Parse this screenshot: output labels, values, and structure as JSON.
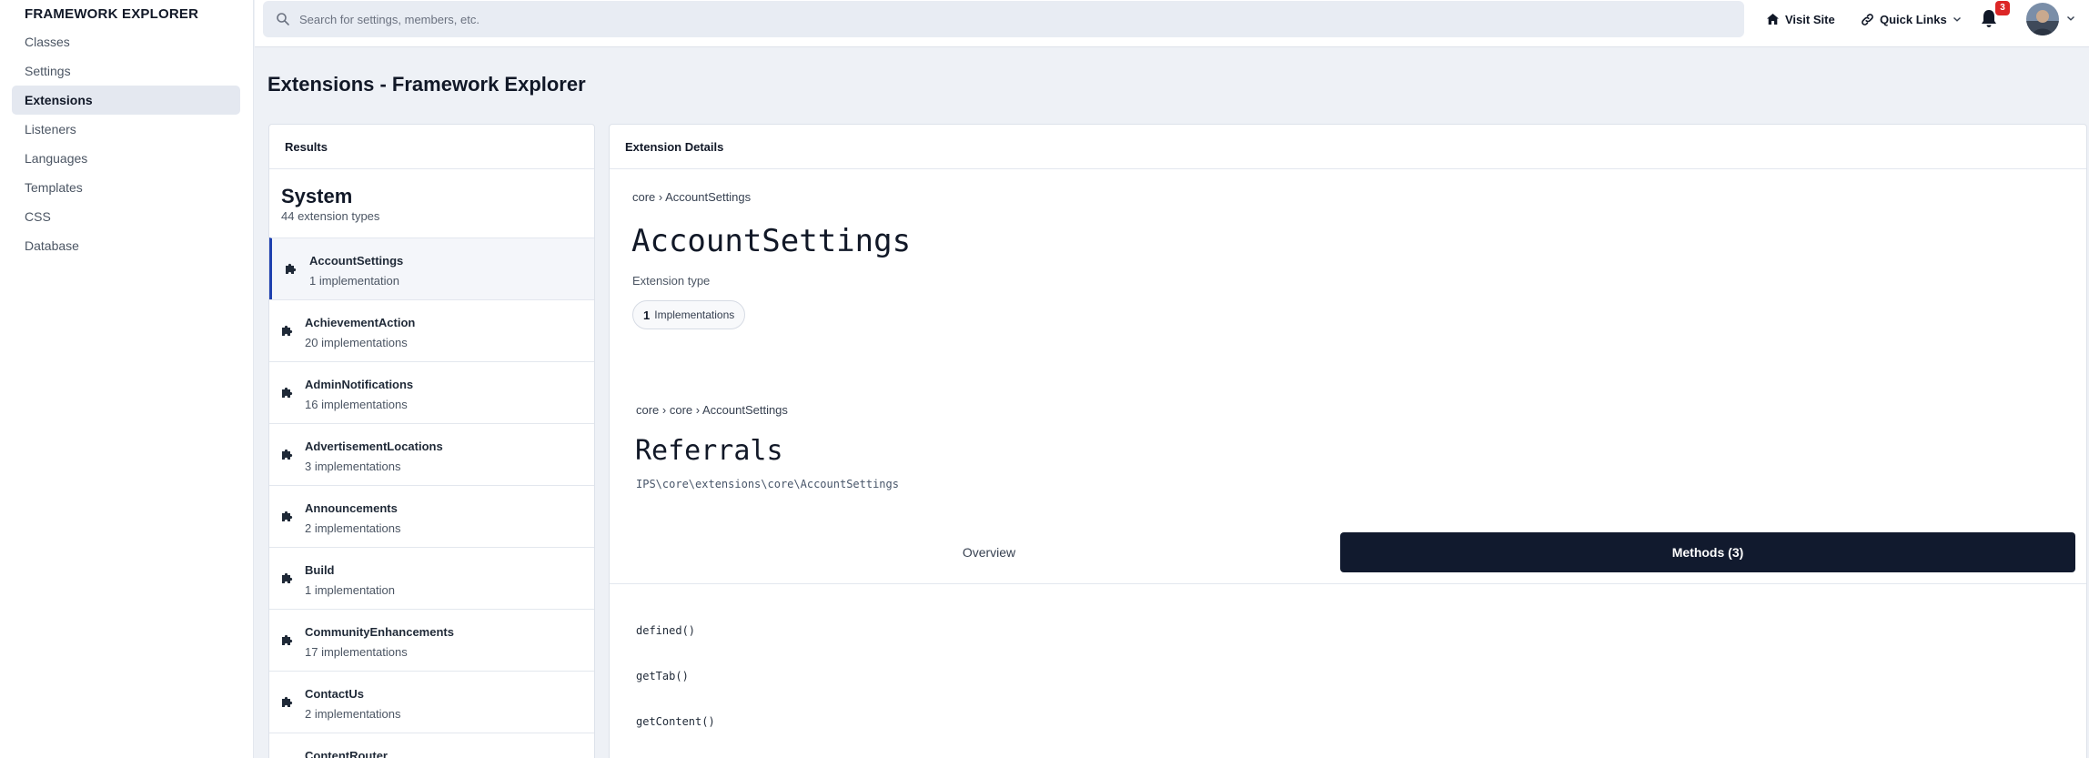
{
  "sidebar": {
    "title": "FRAMEWORK EXPLORER",
    "items": [
      {
        "label": "Classes",
        "active": false
      },
      {
        "label": "Settings",
        "active": false
      },
      {
        "label": "Extensions",
        "active": true
      },
      {
        "label": "Listeners",
        "active": false
      },
      {
        "label": "Languages",
        "active": false
      },
      {
        "label": "Templates",
        "active": false
      },
      {
        "label": "CSS",
        "active": false
      },
      {
        "label": "Database",
        "active": false
      }
    ]
  },
  "topbar": {
    "search_placeholder": "Search for settings, members, etc.",
    "visit_site": "Visit Site",
    "quick_links": "Quick Links",
    "notification_count": "3"
  },
  "page": {
    "title": "Extensions - Framework Explorer"
  },
  "results": {
    "header": "Results",
    "group_title": "System",
    "group_subtitle": "44 extension types",
    "items": [
      {
        "name": "AccountSettings",
        "count": "1 implementation"
      },
      {
        "name": "AchievementAction",
        "count": "20 implementations"
      },
      {
        "name": "AdminNotifications",
        "count": "16 implementations"
      },
      {
        "name": "AdvertisementLocations",
        "count": "3 implementations"
      },
      {
        "name": "Announcements",
        "count": "2 implementations"
      },
      {
        "name": "Build",
        "count": "1 implementation"
      },
      {
        "name": "CommunityEnhancements",
        "count": "17 implementations"
      },
      {
        "name": "ContactUs",
        "count": "2 implementations"
      },
      {
        "name": "ContentRouter",
        "count": ""
      }
    ]
  },
  "details": {
    "header": "Extension Details",
    "breadcrumb": "core › AccountSettings",
    "name": "AccountSettings",
    "type_label": "Extension type",
    "impl_count": "1",
    "impl_label": "Implementations",
    "impl_breadcrumb": "core › core › AccountSettings",
    "impl_name": "Referrals",
    "impl_namespace": "IPS\\core\\extensions\\core\\AccountSettings",
    "tab_overview": "Overview",
    "tab_methods": "Methods (3)",
    "methods": [
      "defined()",
      "getTab()",
      "getContent()"
    ]
  },
  "colors": {
    "accent": "#1e40af",
    "dark_tab": "#111a2e",
    "badge": "#dc2626"
  }
}
